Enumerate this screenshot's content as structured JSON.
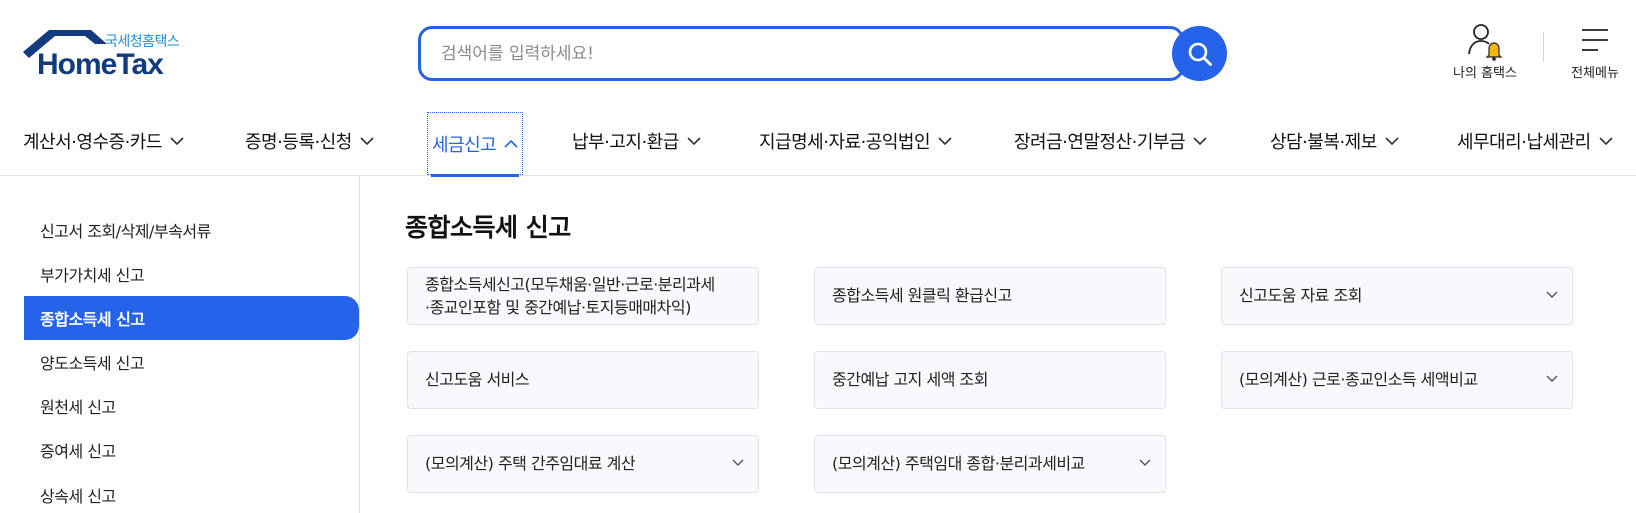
{
  "header": {
    "logo_sub": "국세청홈택스",
    "logo_main": "HomeTax",
    "search_placeholder": "검색어를 입력하세요!",
    "my_hometax_label": "나의 홈택스",
    "all_menu_label": "전체메뉴"
  },
  "gnb": {
    "items": [
      {
        "label": "계산서·영수증·카드"
      },
      {
        "label": "증명·등록·신청"
      },
      {
        "label": "세금신고"
      },
      {
        "label": "납부·고지·환급"
      },
      {
        "label": "지급명세·자료·공익법인"
      },
      {
        "label": "장려금·연말정산·기부금"
      },
      {
        "label": "상담·불복·제보"
      },
      {
        "label": "세무대리·납세관리"
      }
    ],
    "active_label": "세금신고"
  },
  "lnb": {
    "items": [
      {
        "label": "신고서 조회/삭제/부속서류"
      },
      {
        "label": "부가가치세 신고"
      },
      {
        "label": "종합소득세 신고"
      },
      {
        "label": "양도소득세 신고"
      },
      {
        "label": "원천세 신고"
      },
      {
        "label": "증여세 신고"
      },
      {
        "label": "상속세 신고"
      }
    ],
    "active_label": "종합소득세 신고"
  },
  "content": {
    "title": "종합소득세 신고",
    "cards": [
      {
        "label": "종합소득세신고(모두채움·일반·근로·분리과세·종교인포함 및 중간예납·토지등매매차익)",
        "has_dropdown": false
      },
      {
        "label": "종합소득세 원클릭 환급신고",
        "has_dropdown": false
      },
      {
        "label": "신고도움 자료 조회",
        "has_dropdown": true
      },
      {
        "label": "신고도움 서비스",
        "has_dropdown": false
      },
      {
        "label": "중간예납 고지 세액 조회",
        "has_dropdown": false
      },
      {
        "label": "(모의계산) 근로·종교인소득 세액비교",
        "has_dropdown": true
      },
      {
        "label": "(모의계산) 주택 간주임대료 계산",
        "has_dropdown": true
      },
      {
        "label": "(모의계산) 주택임대 종합·분리과세비교",
        "has_dropdown": true
      }
    ]
  },
  "colors": {
    "accent": "#2563eb",
    "logo_navy": "#103b7e",
    "logo_sub": "#1f8fd6",
    "card_bg": "#f8f9fc",
    "bell": "#f5b800"
  },
  "icons": [
    "home-roof-icon",
    "search-icon",
    "user-icon",
    "bell-icon",
    "hamburger-icon",
    "chevron-down-icon",
    "chevron-up-icon"
  ]
}
